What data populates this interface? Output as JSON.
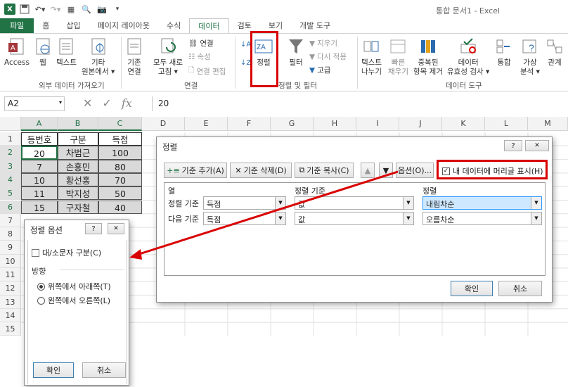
{
  "title_bar": {
    "window_title": "통합 문서1 - Excel"
  },
  "tabs": [
    "파일",
    "홈",
    "삽입",
    "페이지 레이아웃",
    "수식",
    "데이터",
    "검토",
    "보기",
    "개발 도구"
  ],
  "active_tab": "데이터",
  "ribbon": {
    "external": {
      "access": "Access",
      "web": "웹",
      "text": "텍스트",
      "other": "기타\n원본에서 ▾",
      "group": "외부 데이터 가져오기"
    },
    "connections": {
      "existing": "기존\n연결",
      "refresh": "모두 새로\n고침 ▾",
      "conn": "연결",
      "props": "속성",
      "edit_links": "연결 편집",
      "group": "연결"
    },
    "sort_filter": {
      "sort": "정렬",
      "filter": "필터",
      "clear": "지우기",
      "reapply": "다시 적용",
      "advanced": "고급",
      "group": "정렬 및 필터"
    },
    "data_tools": {
      "text_to_col": "텍스트\n나누기",
      "flash": "빠른\n채우기",
      "dups": "중복된\n항목 제거",
      "validation": "데이터\n유효성 검사 ▾",
      "consolidate": "통합",
      "whatif": "가상\n분석 ▾",
      "relations": "관계",
      "group": "데이터 도구"
    }
  },
  "formula_bar": {
    "name_box": "A2",
    "value": "20"
  },
  "columns": [
    "A",
    "B",
    "C",
    "D",
    "E",
    "F",
    "G",
    "H",
    "I",
    "J",
    "K",
    "L",
    "M"
  ],
  "rows": [
    "1",
    "2",
    "3",
    "4",
    "5",
    "6",
    "7",
    "8",
    "9",
    "10",
    "11",
    "12",
    "13",
    "14",
    "15"
  ],
  "table": {
    "headers": [
      "등번호",
      "구분",
      "득점"
    ],
    "rows": [
      [
        "20",
        "차범근",
        "100"
      ],
      [
        "7",
        "손흥민",
        "80"
      ],
      [
        "10",
        "황선홍",
        "70"
      ],
      [
        "11",
        "박지성",
        "50"
      ],
      [
        "15",
        "구자철",
        "40"
      ]
    ]
  },
  "sort_dialog": {
    "title": "정렬",
    "help": "?",
    "close": "✕",
    "add_level": "기준 추가(A)",
    "delete_level": "기준 삭제(D)",
    "copy_level": "기준 복사(C)",
    "options": "옵션(O)...",
    "has_headers": "내 데이터에 머리글 표시(H)",
    "col_header": "열",
    "sorton_header": "정렬 기준",
    "order_header": "정렬",
    "levels": [
      {
        "label": "정렬 기준",
        "column": "득점",
        "sort_on": "값",
        "order": "내림차순"
      },
      {
        "label": "다음 기준",
        "column": "득점",
        "sort_on": "값",
        "order": "오름차순"
      }
    ],
    "ok": "확인",
    "cancel": "취소"
  },
  "options_dialog": {
    "title": "정렬 옵션",
    "help": "?",
    "close": "✕",
    "case_sensitive": "대/소문자 구분(C)",
    "orientation": "방향",
    "top_to_bottom": "위쪽에서 아래쪽(T)",
    "left_to_right": "왼쪽에서 오른쪽(L)",
    "ok": "확인",
    "cancel": "취소"
  },
  "colors": {
    "excel_green": "#217346",
    "highlight_red": "#d90000"
  }
}
